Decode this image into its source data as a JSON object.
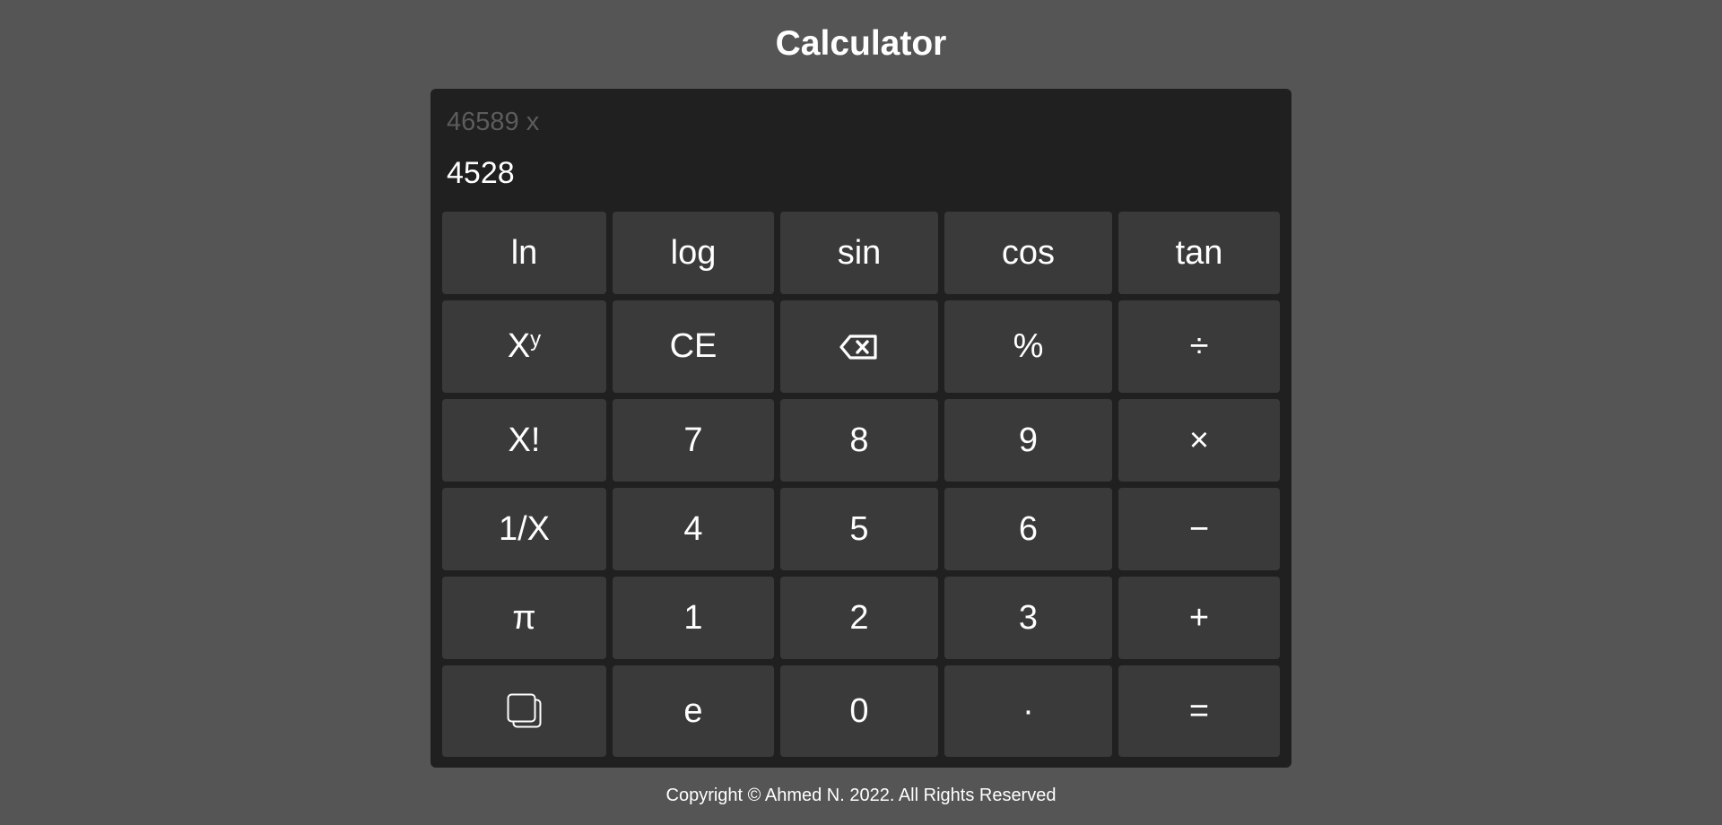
{
  "page": {
    "title": "Calculator"
  },
  "display": {
    "previous": "46589 x",
    "current": "4528"
  },
  "keys": {
    "ln": "ln",
    "log": "log",
    "sin": "sin",
    "cos": "cos",
    "tan": "tan",
    "power_base": "X",
    "power_exp": "y",
    "ce": "CE",
    "backspace_icon": "backspace-icon",
    "percent": "%",
    "divide": "÷",
    "factorial": "X!",
    "seven": "7",
    "eight": "8",
    "nine": "9",
    "multiply": "×",
    "reciprocal": "1/X",
    "four": "4",
    "five": "5",
    "six": "6",
    "minus": "−",
    "pi": "π",
    "one": "1",
    "two": "2",
    "three": "3",
    "plus": "+",
    "copy_icon": "copy-icon",
    "e": "e",
    "zero": "0",
    "decimal": "·",
    "equals": "="
  },
  "footer": {
    "text": "Copyright © Ahmed N. 2022. All Rights Reserved"
  },
  "colors": {
    "page_background": "#555555",
    "calculator_background": "#202020",
    "key_background": "#3a3a3a",
    "previous_text": "#5c5c5c",
    "text": "#ffffff"
  }
}
